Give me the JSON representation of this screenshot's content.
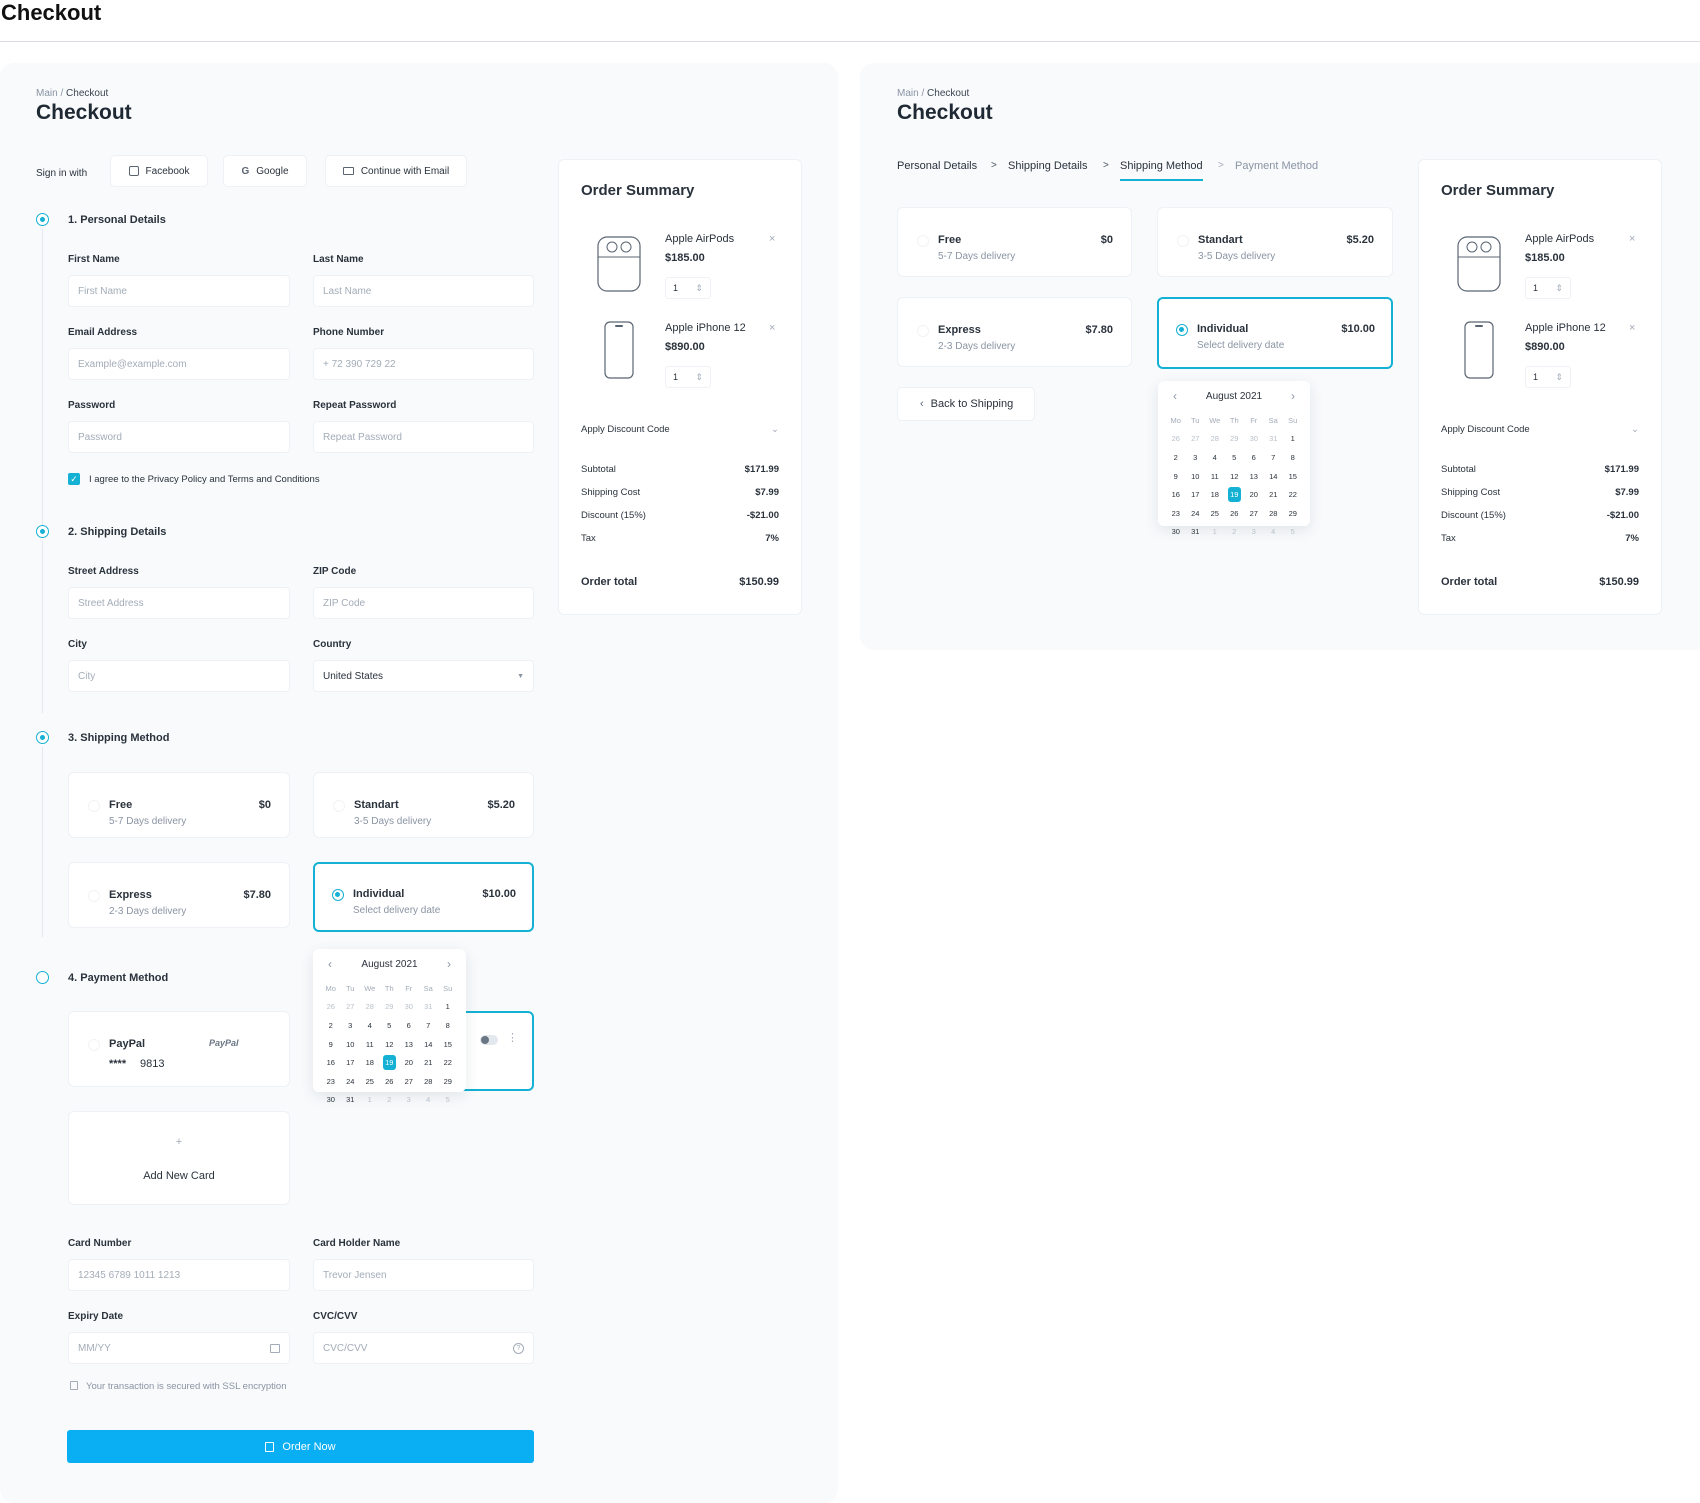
{
  "header": {
    "title": "Checkout"
  },
  "breadcrumb": {
    "root": "Main",
    "sep": "/",
    "current": "Checkout"
  },
  "page_title": "Checkout",
  "signin": {
    "label": "Sign in with",
    "facebook": "Facebook",
    "google": "Google",
    "email": "Continue with Email"
  },
  "personal": {
    "heading": "1. Personal Details",
    "first_name_label": "First Name",
    "first_name_ph": "First Name",
    "last_name_label": "Last Name",
    "last_name_ph": "Last Name",
    "email_label": "Email Address",
    "email_ph": "Example@example.com",
    "phone_label": "Phone Number",
    "phone_ph": "+ 72 390 729 22",
    "password_label": "Password",
    "password_ph": "Password",
    "repeat_label": "Repeat Password",
    "repeat_ph": "Repeat Password",
    "agree": "I agree to the Privacy Policy and Terms and Conditions"
  },
  "shipping_details": {
    "heading": "2. Shipping Details",
    "street_label": "Street Address",
    "street_ph": "Street Address",
    "zip_label": "ZIP Code",
    "zip_ph": "ZIP Code",
    "city_label": "City",
    "city_ph": "City",
    "country_label": "Country",
    "country_value": "United States"
  },
  "shipping_method": {
    "heading": "3. Shipping Method",
    "options": [
      {
        "name": "Free",
        "desc": "5-7 Days delivery",
        "price": "$0"
      },
      {
        "name": "Standart",
        "desc": "3-5 Days delivery",
        "price": "$5.20"
      },
      {
        "name": "Express",
        "desc": "2-3 Days delivery",
        "price": "$7.80"
      },
      {
        "name": "Individual",
        "desc": "Select delivery date",
        "price": "$10.00"
      }
    ],
    "selected": "Individual"
  },
  "calendar": {
    "month": "August 2021",
    "weekdays": [
      "Mo",
      "Tu",
      "We",
      "Th",
      "Fr",
      "Sa",
      "Su"
    ],
    "days": [
      [
        "26",
        "27",
        "28",
        "29",
        "30",
        "31",
        "1"
      ],
      [
        "2",
        "3",
        "4",
        "5",
        "6",
        "7",
        "8"
      ],
      [
        "9",
        "10",
        "11",
        "12",
        "13",
        "14",
        "15"
      ],
      [
        "16",
        "17",
        "18",
        "19",
        "20",
        "21",
        "22"
      ],
      [
        "23",
        "24",
        "25",
        "26",
        "27",
        "28",
        "29"
      ],
      [
        "30",
        "31",
        "1",
        "2",
        "3",
        "4",
        "5"
      ]
    ],
    "selected_day": "19"
  },
  "payment": {
    "heading": "4. Payment Method",
    "paypal_name": "PayPal",
    "paypal_logo": "PayPal",
    "masked": "****",
    "last4": "9813",
    "add_card": "Add New Card",
    "add_icon": "+",
    "card_number_label": "Card Number",
    "card_number_ph": "12345 6789 1011 1213",
    "holder_label": "Card Holder Name",
    "holder_ph": "Trevor Jensen",
    "expiry_label": "Expiry Date",
    "expiry_ph": "MM/YY",
    "cvc_label": "CVC/CVV",
    "cvc_ph": "CVC/CVV",
    "secure_note": "Your transaction is secured with SSL encryption",
    "order_button": "Order Now"
  },
  "order_summary": {
    "title": "Order Summary",
    "items": [
      {
        "name": "Apple AirPods",
        "price": "$185.00",
        "qty": "1"
      },
      {
        "name": "Apple iPhone 12",
        "price": "$890.00",
        "qty": "1"
      }
    ],
    "discount_code": "Apply Discount Code",
    "subtotal_label": "Subtotal",
    "subtotal": "$171.99",
    "shipping_label": "Shipping Cost",
    "shipping": "$7.99",
    "discount_label": "Discount (15%)",
    "discount": "-$21.00",
    "tax_label": "Tax",
    "tax": "7%",
    "total_label": "Order total",
    "total": "$150.99"
  },
  "steps": {
    "s1": "Personal Details",
    "s2": "Shipping Details",
    "s3": "Shipping Method",
    "s4": "Payment Method",
    "sep": ">"
  },
  "back": "Back to Shipping",
  "colors": {
    "accent": "#14b1d4",
    "button": "#0aaef2",
    "panel_bg": "#f8fafc"
  }
}
